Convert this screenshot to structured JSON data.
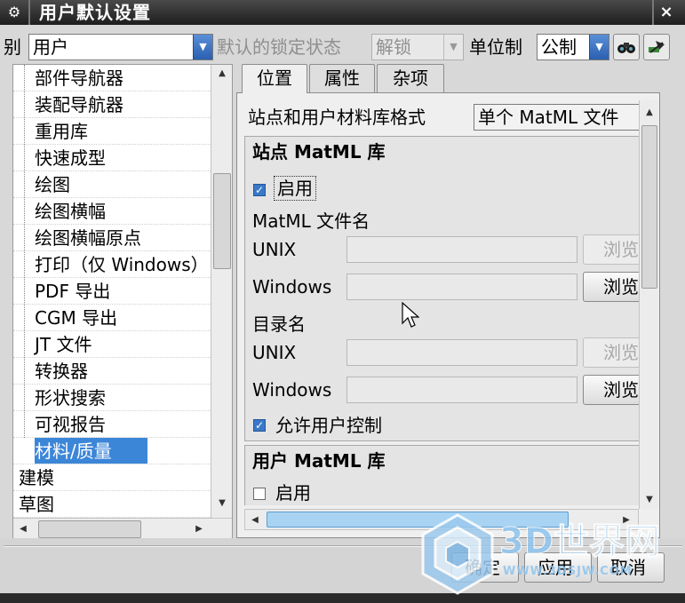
{
  "window": {
    "title": "用户默认设置",
    "close_glyph": "×",
    "gear_glyph": "⚙"
  },
  "toolbar": {
    "level_label_partial": "别",
    "level_value": "用户",
    "lock_label": "默认的锁定状态",
    "lock_value": "解锁",
    "unit_label": "单位制",
    "unit_value": "公制"
  },
  "tree": {
    "children": [
      "部件导航器",
      "装配导航器",
      "重用库",
      "快速成型",
      "绘图",
      "绘图横幅",
      "绘图横幅原点",
      "打印（仅 Windows）",
      "PDF 导出",
      "CGM 导出",
      "JT 文件",
      "转换器",
      "形状搜索",
      "可视报告",
      "材料/质量"
    ],
    "top_items": [
      "建模",
      "草图"
    ],
    "selected": "材料/质量"
  },
  "tabs": [
    "位置",
    "属性",
    "杂项"
  ],
  "panel": {
    "format_label": "站点和用户材料库格式",
    "format_value": "单个 MatML 文件",
    "site_group": {
      "title": "站点 MatML 库",
      "enable_label": "启用",
      "enable_checked": true,
      "file_label": "MatML 文件名",
      "unix_label": "UNIX",
      "windows_label": "Windows",
      "dir_label": "目录名",
      "dir_unix_label": "UNIX",
      "dir_windows_label": "Windows",
      "browse": "浏览",
      "allow_label": "允许用户控制",
      "allow_checked": true
    },
    "user_group": {
      "title": "用户 MatML 库",
      "enable_label": "启用",
      "enable_checked": false
    }
  },
  "footer": {
    "ok": "确定",
    "apply": "应用",
    "cancel": "取消"
  },
  "watermark": {
    "brand": "3D世界网",
    "url": "WWW.3DSJW.COM"
  }
}
